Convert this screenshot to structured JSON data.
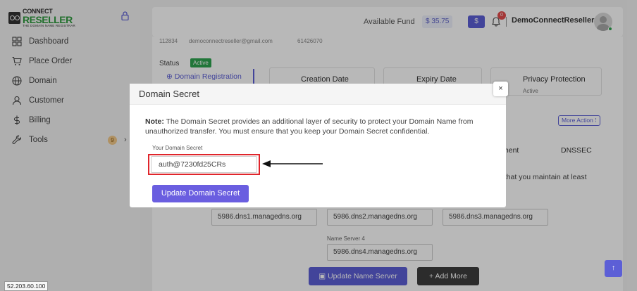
{
  "brand": {
    "line1": "CONNECT",
    "line2": "RESELLER",
    "tagline": "THE DOMAIN NAME REGISTRAR"
  },
  "sidebar": {
    "items": [
      {
        "label": "Dashboard",
        "icon": "grid-icon"
      },
      {
        "label": "Place Order",
        "icon": "cart-icon"
      },
      {
        "label": "Domain",
        "icon": "globe-icon"
      },
      {
        "label": "Customer",
        "icon": "user-icon"
      },
      {
        "label": "Billing",
        "icon": "dollar-icon"
      },
      {
        "label": "Tools",
        "icon": "wrench-icon",
        "badge": "9"
      }
    ]
  },
  "header": {
    "fund_label": "Available Fund",
    "fund_value": "$ 35.75",
    "dollar_button": "$",
    "notification_count": "0",
    "username": "DemoConnectReseller"
  },
  "background": {
    "info": [
      "112834",
      "democonnectreseller@gmail.com",
      "61426070"
    ],
    "status_label": "Status",
    "status_value": "Active",
    "domain_registration": "Domain Registration",
    "boxes": [
      {
        "title": "Creation Date"
      },
      {
        "title": "Expiry Date"
      },
      {
        "title": "Privacy Protection",
        "sub": "Active"
      }
    ],
    "more_action": "More Action ⁝",
    "tab_management": "ment",
    "tab_dnssec": "DNSSEC",
    "maintain_text": "e that you maintain at least",
    "name_servers": [
      "5986.dns1.managedns.org",
      "5986.dns2.managedns.org",
      "5986.dns3.managedns.org",
      "5986.dns4.managedns.org"
    ],
    "name_server_4_label": "Name Server 4",
    "update_ns_button": "Update Name Server",
    "add_more_button": "+ Add More"
  },
  "modal": {
    "title": "Domain Secret",
    "close": "×",
    "note_bold": "Note:",
    "note_text": " The Domain Secret provides an additional layer of security to protect your Domain Name from unauthorized transfer. You must ensure that you keep your Domain Secret confidential.",
    "secret_label": "Your Domain Secret",
    "secret_value": "auth@7230fd25CRs",
    "update_button": "Update Domain Secret"
  },
  "footer": {
    "ip": "52.203.60.100",
    "scroll_top": "↑"
  },
  "colors": {
    "accent": "#5c5fd6",
    "status_green": "#2ea44f",
    "highlight_red": "#e0252b"
  }
}
